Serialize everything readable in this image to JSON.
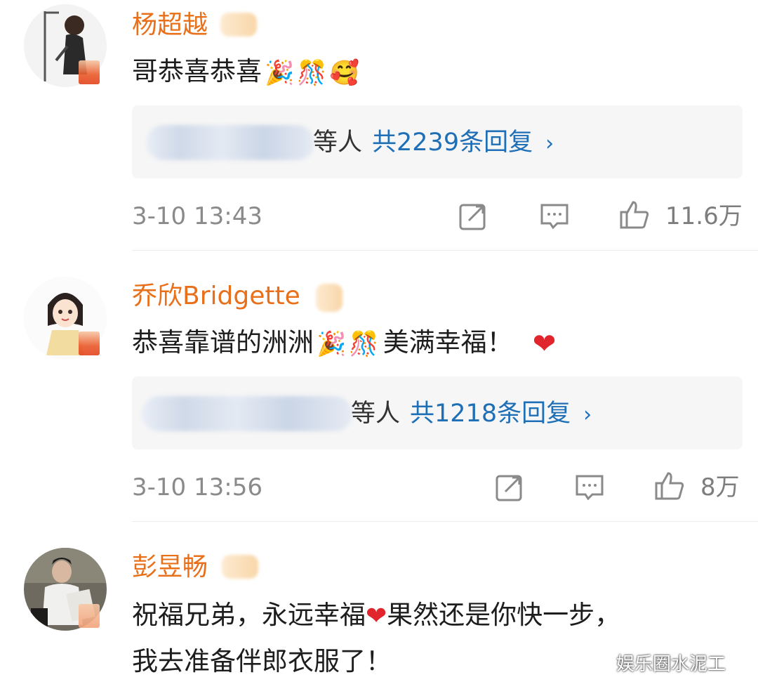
{
  "comments": [
    {
      "username": "杨超越",
      "text": "哥恭喜恭喜",
      "emojis": [
        "🎉",
        "🎊",
        "🥰"
      ],
      "reply_suffix": "等人",
      "reply_count": "共2239条回复",
      "reply_chevron": "›",
      "time": "3-10 13:43",
      "likes": "11.6万"
    },
    {
      "username": "乔欣Bridgette",
      "text_a": "恭喜靠谱的洲洲",
      "emojis": [
        "🎉",
        "🎊"
      ],
      "text_b": "美满幸福！",
      "heart": "❤",
      "reply_suffix": "等人",
      "reply_count": "共1218条回复",
      "reply_chevron": "›",
      "time": "3-10 13:56",
      "likes": "8万"
    },
    {
      "username": "彭昱畅",
      "line1_a": "祝福兄弟，永远幸福",
      "heart": "❤",
      "line1_b": "果然还是你快一步，",
      "line2": "我去准备伴郎衣服了！"
    }
  ],
  "watermark": {
    "text": "娱乐圈水泥工"
  },
  "icons": {
    "repost": "repost-icon",
    "comment": "comment-icon",
    "like": "thumbs-up-icon"
  },
  "colors": {
    "username": "#e8701a",
    "reply_link": "#1f6fb6",
    "meta": "#8a8a8a",
    "heart": "#e0252c"
  }
}
